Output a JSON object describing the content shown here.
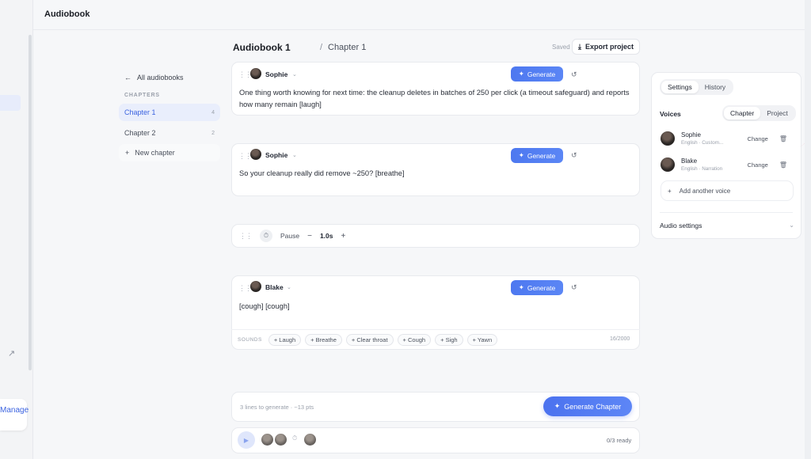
{
  "header": {
    "app_title": "Audiobook"
  },
  "leftbar": {
    "manage_label": "Manage"
  },
  "breadcrumb": {
    "book_title": "Audiobook 1",
    "separator": "/",
    "chapter": "Chapter 1",
    "saved_label": "Saved",
    "export_label": "Export project"
  },
  "chapter_sidebar": {
    "back_label": "All audiobooks",
    "section_label": "CHAPTERS",
    "chapters": [
      {
        "label": "Chapter 1",
        "count": "4"
      },
      {
        "label": "Chapter 2",
        "count": "2"
      }
    ],
    "new_label": "New chapter"
  },
  "blocks": [
    {
      "speaker": "Sophie",
      "generate_label": "Generate",
      "text": "One thing worth knowing for next time: the cleanup deletes in batches of 250 per click (a timeout safeguard) and reports how many remain [laugh]"
    },
    {
      "speaker": "Sophie",
      "generate_label": "Generate",
      "text": "So your cleanup really did remove ~250? [breathe]"
    },
    {
      "speaker": "Blake",
      "generate_label": "Generate",
      "text": "[cough] [cough]"
    }
  ],
  "pause": {
    "label": "Pause",
    "minus": "−",
    "value": "1.0s",
    "plus": "+"
  },
  "sounds": {
    "label": "SOUNDS",
    "chips": [
      "+ Laugh",
      "+ Breathe",
      "+ Clear throat",
      "+ Cough",
      "+ Sigh",
      "+ Yawn"
    ],
    "char_count": "16/2000"
  },
  "footer": {
    "summary": "3 lines to generate · ~13 pts",
    "generate_chapter_label": "Generate Chapter",
    "ready_label": "0/3 ready"
  },
  "right_panel": {
    "tabs": [
      "Settings",
      "History"
    ],
    "voices_label": "Voices",
    "scope_tabs": [
      "Chapter",
      "Project"
    ],
    "voices": [
      {
        "name": "Sophie",
        "sub": "English · Custom...",
        "change_label": "Change"
      },
      {
        "name": "Blake",
        "sub": "English · Narration",
        "change_label": "Change"
      }
    ],
    "add_voice_label": "Add another voice",
    "audio_settings_label": "Audio settings"
  },
  "colors": {
    "accent": "#4d78f0",
    "active_chapter_bg": "#e9eefc",
    "background": "#f6f7f9"
  }
}
